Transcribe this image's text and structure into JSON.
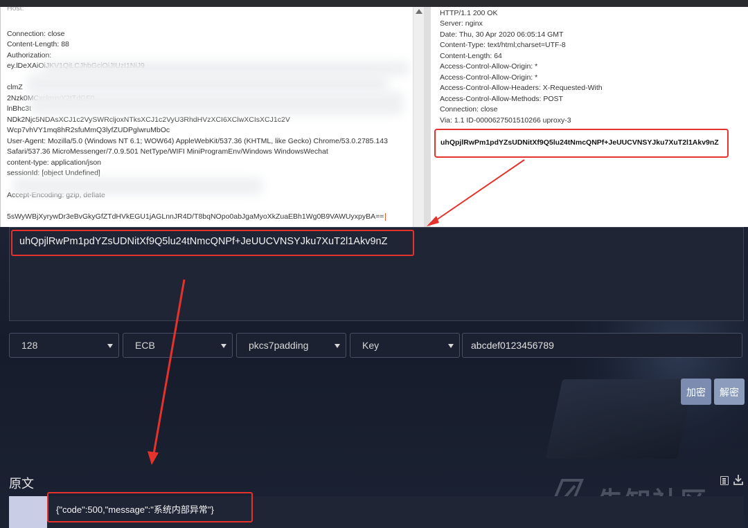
{
  "request": {
    "lines": [
      "Connection: close",
      "Content-Length: 88",
      "Authorization:",
      "ey.lDeXAiOiJKV1QiLCJhbGciOiJIUzI1NiJ9",
      "clmZ",
      "2Nzk0MCxclmxvY2tTdGF0",
      "lnBhc3t",
      "NDk2Njc5NDAsXCJ1c2VySWRcljoxNTksXCJ1c2VyU3RhdHVzXCI6XClwXCIsXCJ1c2V",
      "Wcp7vhVY1mq8hR2sfuMmQ3lyfZUDPglwruMbOc",
      "User-Agent: Mozilla/5.0 (Windows NT 6.1; WOW64) AppleWebKit/537.36 (KHTML, like Gecko) Chrome/53.0.2785.143",
      "Safari/537.36 MicroMessenger/7.0.9.501 NetType/WIFI MiniProgramEnv/Windows WindowsWechat",
      "content-type: application/json",
      "sessionId: [object Undefined]",
      "Accept-Encoding: gzip, deflate",
      "5sWyWBjXyrywDr3eBvGkyGfZTdHVkEGU1jAGLnnJR4D/T8bqNOpo0abJgaMyoXkZuaEBh1Wg0B9VAWUyxpyBA=="
    ]
  },
  "response": {
    "lines": [
      "HTTP/1.1 200 OK",
      "Server: nginx",
      "Date: Thu, 30 Apr 2020 06:05:14 GMT",
      "Content-Type: text/html;charset=UTF-8",
      "Content-Length: 64",
      "Access-Control-Allow-Origin: *",
      "Access-Control-Allow-Origin: *",
      "Access-Control-Allow-Headers: X-Requested-With",
      "Access-Control-Allow-Methods: POST",
      "Connection: close",
      "Via: 1.1 ID-0000627501510266 uproxy-3"
    ],
    "cipher_body": "uhQpjlRwPm1pdYZsUDNitXf9Q5lu24tNmcQNPf+JeUUCVNSYJku7XuT2l1Akv9nZ"
  },
  "tool": {
    "ciphertext": "uhQpjlRwPm1pdYZsUDNitXf9Q5lu24tNmcQNPf+JeUUCVNSYJku7XuT2l1Akv9nZ",
    "key_size": "128",
    "mode": "ECB",
    "padding": "pkcs7padding",
    "key_type": "Key",
    "key_value": "abcdef0123456789",
    "encrypt_label": "加密",
    "decrypt_label": "解密",
    "plaintext_label": "原文",
    "plaintext": "{\"code\":500,\"message\":\"系统内部异常\"}",
    "watermark": "先知社区"
  },
  "colors": {
    "highlight_red": "#e5322d",
    "tool_background": "#1a2030",
    "button": "#7b8cb0"
  }
}
